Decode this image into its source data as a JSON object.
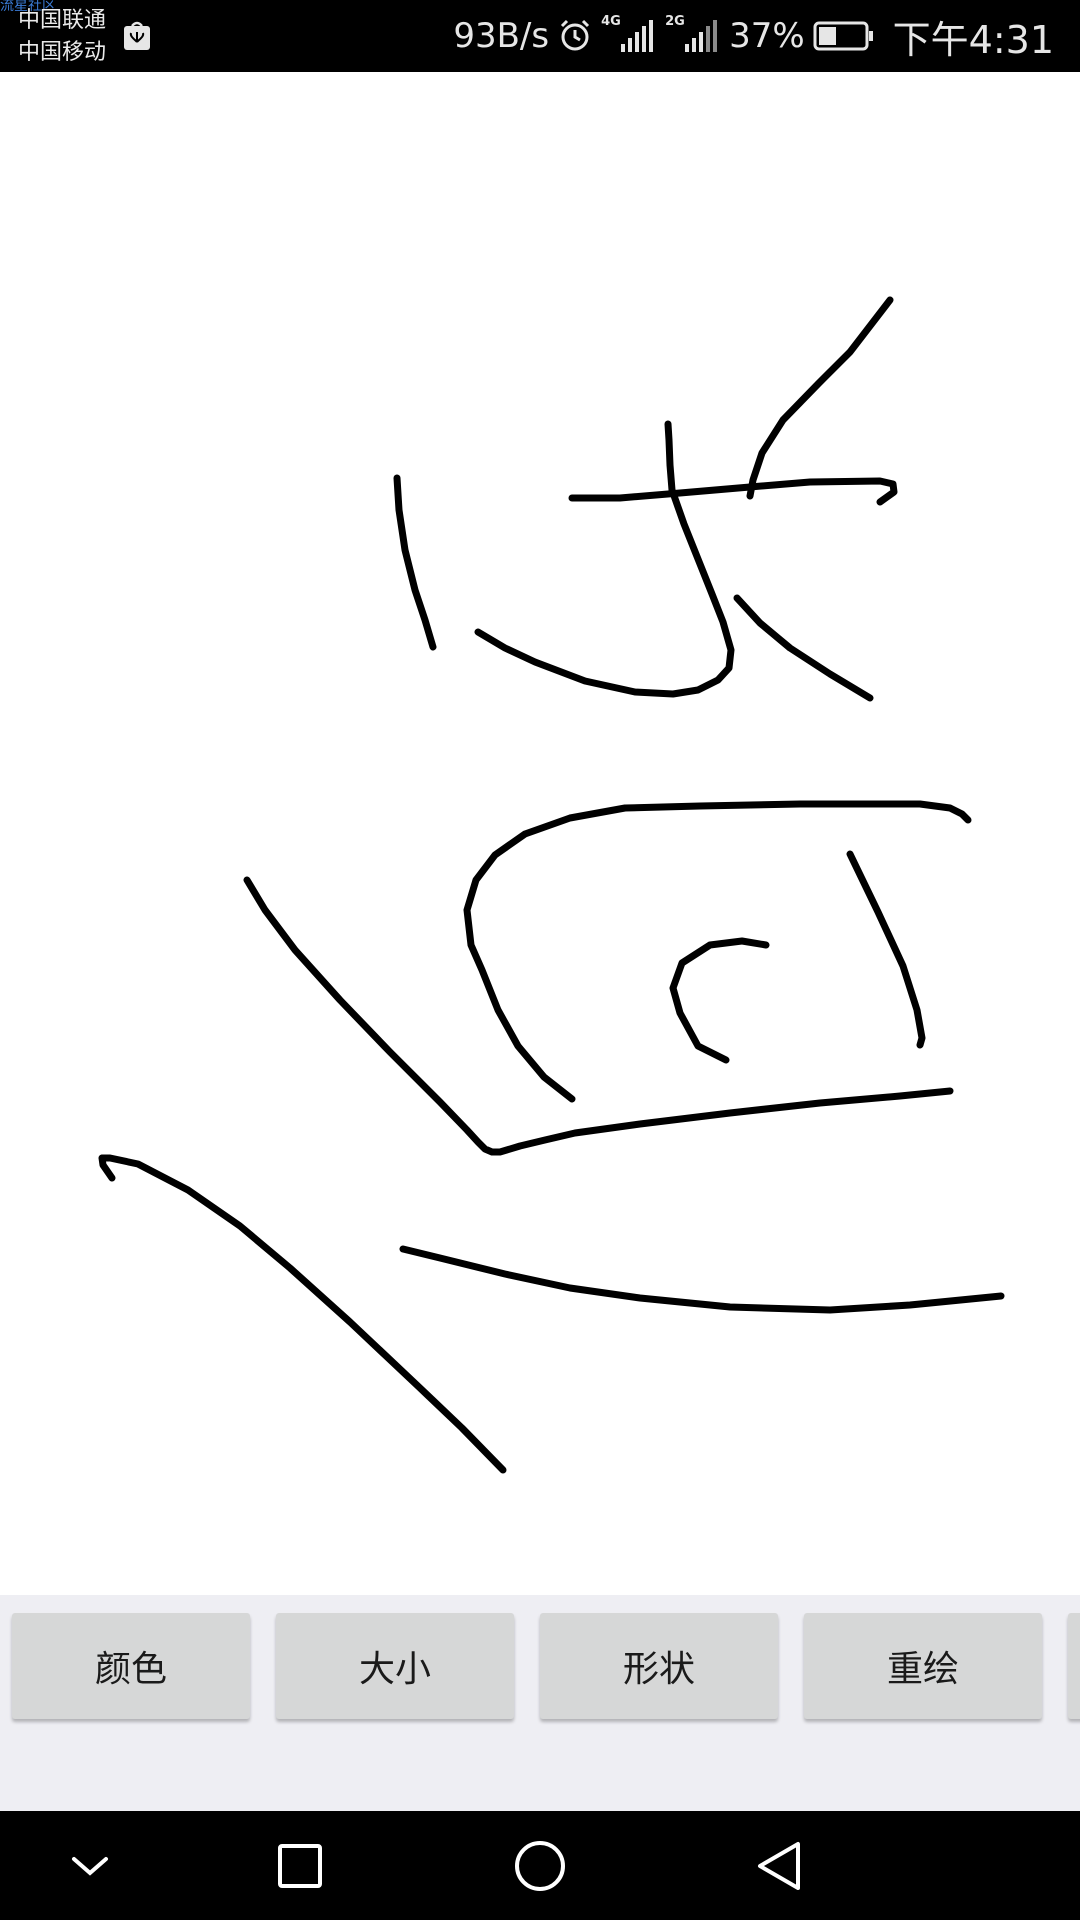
{
  "status_bar": {
    "watermark": "流星社区",
    "carrier_1": "中国联通",
    "carrier_2": "中国移动",
    "net_speed": "93B/s",
    "signal_1_label": "4G",
    "signal_2_label": "2G",
    "battery_percent": "37%",
    "time": "下午4:31",
    "icons": [
      "huawei-store-icon",
      "alarm-icon",
      "signal-4g-icon",
      "signal-2g-icon",
      "battery-icon"
    ]
  },
  "canvas": {
    "stroke_color": "#000000",
    "background": "#ffffff"
  },
  "toolbar": {
    "buttons": [
      {
        "label": "颜色"
      },
      {
        "label": "大小"
      },
      {
        "label": "形状"
      },
      {
        "label": "重绘"
      }
    ]
  },
  "nav_bar": {
    "buttons": [
      "chevron-down-icon",
      "recents-square-icon",
      "home-circle-icon",
      "back-triangle-icon"
    ]
  }
}
